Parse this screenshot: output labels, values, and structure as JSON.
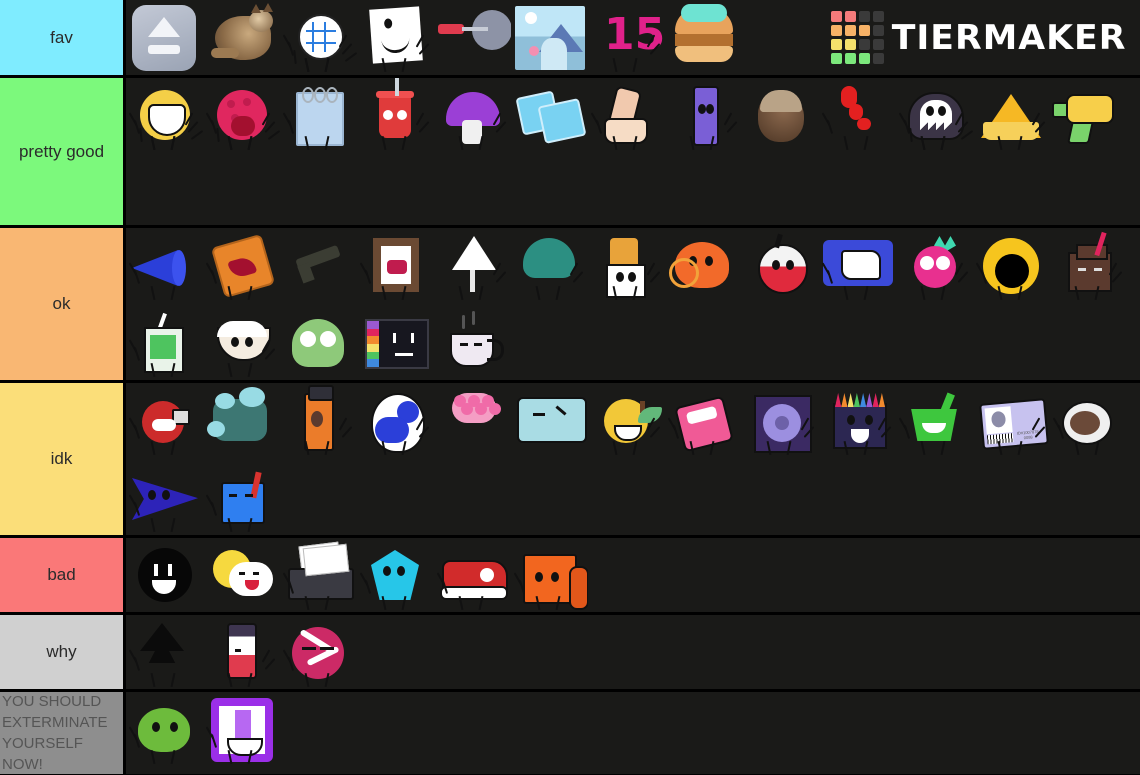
{
  "app": {
    "brand": "TIERMAKER",
    "background_color": "#1a1a18",
    "border_color": "#000000"
  },
  "brand_grid_colors": [
    "#F47B7B",
    "#F47B7B",
    "#3a3a3a",
    "#3a3a3a",
    "#F7B267",
    "#F7B267",
    "#F7B267",
    "#3a3a3a",
    "#F5E16C",
    "#F5E16C",
    "#3a3a3a",
    "#3a3a3a",
    "#7CE87C",
    "#7CE87C",
    "#7CE87C",
    "#3a3a3a"
  ],
  "tiers": [
    {
      "label": "fav",
      "color": "#7FECFF",
      "text_color": "#2b2b2b",
      "items": [
        {
          "name": "eject-button-icon",
          "type": "eject"
        },
        {
          "name": "cat-photo",
          "type": "cat"
        },
        {
          "name": "grid-ball-character",
          "type": "gridball"
        },
        {
          "name": "white-paper-character",
          "type": "paper"
        },
        {
          "name": "screwdriver-bowl-character",
          "type": "screwdriver"
        },
        {
          "name": "landscape-photo",
          "type": "landscape"
        },
        {
          "name": "pink-fifteen-character",
          "type": "fifteen",
          "text": "15"
        },
        {
          "name": "burger-character",
          "type": "burger"
        }
      ]
    },
    {
      "label": "pretty good",
      "color": "#7CF97C",
      "text_color": "#2b2b2b",
      "items": [
        {
          "name": "yellow-smiley-character",
          "type": "yellowsmile"
        },
        {
          "name": "pink-bowling-ball-character",
          "type": "bowling"
        },
        {
          "name": "notepad-character",
          "type": "notepad"
        },
        {
          "name": "soda-cup-character",
          "type": "cup"
        },
        {
          "name": "purple-mushroom-character",
          "type": "mushroom"
        },
        {
          "name": "ice-cubes-character",
          "type": "icecubes"
        },
        {
          "name": "lotion-bottle-character",
          "type": "lotion"
        },
        {
          "name": "purple-remote-character",
          "type": "remote"
        },
        {
          "name": "head-photo",
          "type": "headphoto"
        },
        {
          "name": "red-squiggle-character",
          "type": "redsquiggle"
        },
        {
          "name": "dark-ghost-character",
          "type": "ghost"
        },
        {
          "name": "cheese-wedge-character",
          "type": "cheese"
        },
        {
          "name": "water-gun-character",
          "type": "watergun"
        }
      ]
    },
    {
      "label": "ok",
      "color": "#F9B773",
      "text_color": "#2b2b2b",
      "items": [
        {
          "name": "blue-megaphone-character",
          "type": "megaphone"
        },
        {
          "name": "orange-cracker-character",
          "type": "cracker"
        },
        {
          "name": "dark-gun-character",
          "type": "gun"
        },
        {
          "name": "picture-frame-character",
          "type": "frame"
        },
        {
          "name": "warning-sign-character",
          "type": "warning"
        },
        {
          "name": "teal-bush-character",
          "type": "bush"
        },
        {
          "name": "white-carton-character",
          "type": "carton"
        },
        {
          "name": "orange-slime-character",
          "type": "slime"
        },
        {
          "name": "red-bomb-character",
          "type": "bomb"
        },
        {
          "name": "blue-57-character",
          "type": "blue57"
        },
        {
          "name": "pink-fruit-character",
          "type": "pinkfruit"
        },
        {
          "name": "yellow-blob-character",
          "type": "yellowblob"
        },
        {
          "name": "chocolate-milk-character",
          "type": "chocmilk"
        },
        {
          "name": "juice-box-character",
          "type": "juicebox"
        },
        {
          "name": "rice-bowl-character",
          "type": "ricebowl"
        },
        {
          "name": "green-slime-character",
          "type": "greenslime"
        },
        {
          "name": "color-palette-screen-character",
          "type": "palette"
        },
        {
          "name": "teacup-character",
          "type": "teacup"
        }
      ]
    },
    {
      "label": "idk",
      "color": "#FBDE79",
      "text_color": "#2b2b2b",
      "items": [
        {
          "name": "red-bauble-character",
          "type": "bauble"
        },
        {
          "name": "cyan-sprout-character",
          "type": "sprout"
        },
        {
          "name": "spray-can-character",
          "type": "spray"
        },
        {
          "name": "blue-egg-character",
          "type": "egg"
        },
        {
          "name": "flower-bouquet-character",
          "type": "bouquet"
        },
        {
          "name": "ice-block-character",
          "type": "iceblock"
        },
        {
          "name": "golden-apple-character",
          "type": "apple"
        },
        {
          "name": "pink-bag-character",
          "type": "pinkbag"
        },
        {
          "name": "purple-cd-character",
          "type": "cd"
        },
        {
          "name": "crayon-box-character",
          "type": "crayons"
        },
        {
          "name": "green-basket-character",
          "type": "basket"
        },
        {
          "name": "id-card-character",
          "type": "idcard",
          "text": "ID#1007878 0088"
        },
        {
          "name": "coffee-mug-character",
          "type": "coffeemug"
        },
        {
          "name": "blue-arrow-character",
          "type": "bluearrow"
        },
        {
          "name": "paint-bucket-character",
          "type": "paint"
        }
      ]
    },
    {
      "label": "bad",
      "color": "#FA7878",
      "text_color": "#2b2b2b",
      "items": [
        {
          "name": "black-face-character",
          "type": "blackface"
        },
        {
          "name": "sun-cloud-character",
          "type": "suncloud"
        },
        {
          "name": "printer-character",
          "type": "printer"
        },
        {
          "name": "cyan-crystal-character",
          "type": "crystal"
        },
        {
          "name": "red-sneaker-character",
          "type": "shoe"
        },
        {
          "name": "orange-mat-character",
          "type": "mat"
        }
      ]
    },
    {
      "label": "why",
      "color": "#D0D0D0",
      "text_color": "#2b2b2b",
      "items": [
        {
          "name": "shadow-character",
          "type": "shadow"
        },
        {
          "name": "glue-tube-character",
          "type": "glue"
        },
        {
          "name": "pink-candy-character",
          "type": "candy"
        }
      ]
    },
    {
      "label": "YOU SHOULD EXTERMINATE YOURSELF NOW!",
      "color": "#8E8E8E",
      "text_color": "#555555",
      "small": true,
      "items": [
        {
          "name": "green-creature-character",
          "type": "greencreature"
        },
        {
          "name": "purple-letter-character",
          "type": "purpleletter"
        }
      ]
    }
  ]
}
